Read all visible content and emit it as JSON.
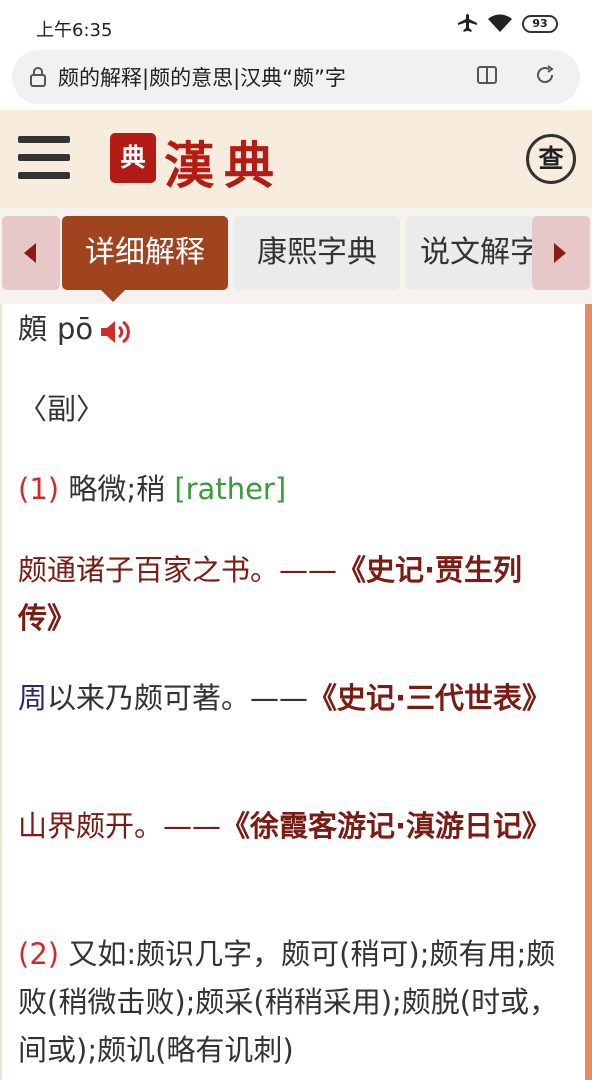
{
  "status_bar": {
    "time": "上午6:35",
    "battery": "93"
  },
  "url_bar": {
    "url": "颇的解释|颇的意思|汉典“颇”字"
  },
  "header": {
    "seal_text": "典",
    "logo_text": "漢典",
    "search_label": "查"
  },
  "tabs": [
    {
      "label": "详细解释"
    },
    {
      "label": "康熙字典"
    },
    {
      "label": "说文解字"
    }
  ],
  "content": {
    "heading_char": "頗",
    "pinyin": "pō",
    "pos": "〈副〉",
    "def1": {
      "num": "(1)",
      "text": "略微;稍",
      "english": "[rather]"
    },
    "ex1": {
      "text": "颇通诸子百家之书。——",
      "source": "《史记·贾生列传》"
    },
    "ex2": {
      "link": "周",
      "text": "以来乃颇可著。——",
      "source": "《史记·三代世表》"
    },
    "ex3": {
      "text": "山界颇开。——",
      "source": "《徐霞客游记·滇游日记》"
    },
    "def2": {
      "num": "(2)",
      "text": "又如:颇识几字，颇可(稍可);颇有用;颇败(稍微击败);颇采(稍稍采用);颇脱(时或，间或);颇讥(略有讥刺)"
    }
  },
  "colors": {
    "brand_red": "#b31c14",
    "tab_active": "#a0431f",
    "source_text": "#7a1c14",
    "number_red": "#d22a2a",
    "english_green": "#3a9b3a"
  }
}
